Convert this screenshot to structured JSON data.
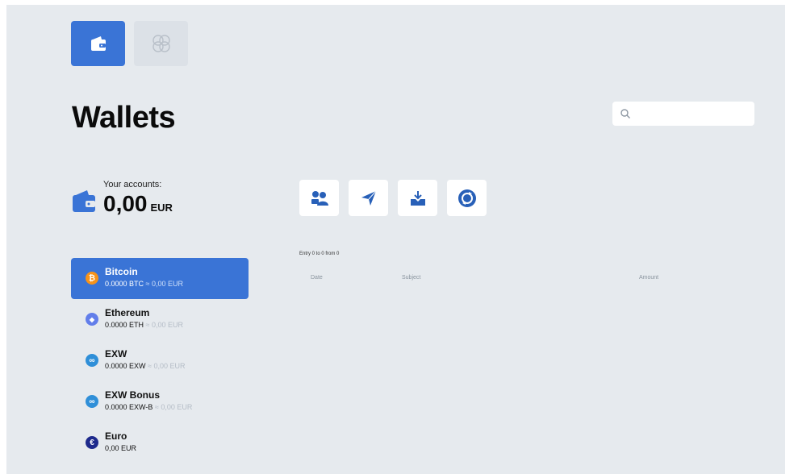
{
  "page": {
    "title": "Wallets"
  },
  "search": {
    "placeholder": ""
  },
  "summary": {
    "label": "Your accounts:",
    "amount": "0,00",
    "currency": "EUR"
  },
  "actions": [
    {
      "icon": "users-icon"
    },
    {
      "icon": "send-icon"
    },
    {
      "icon": "download-icon"
    },
    {
      "icon": "exchange-icon"
    }
  ],
  "transactions": {
    "entry_info": "Entry 0 to 0 from 0",
    "columns": [
      "Date",
      "Subject",
      "Amount"
    ]
  },
  "wallets": [
    {
      "name": "Bitcoin",
      "balance": "0.0000 BTC",
      "sep": " ≈ ",
      "eur": "0,00 EUR",
      "icon": "bitcoin-icon",
      "color": "#f7931a",
      "glyph": "₿",
      "active": true
    },
    {
      "name": "Ethereum",
      "balance": "0.0000 ETH",
      "sep": " ≈ ",
      "eur": "0,00 EUR",
      "icon": "ethereum-icon",
      "color": "#627eea",
      "glyph": "◆",
      "active": false
    },
    {
      "name": "EXW",
      "balance": "0.0000 EXW",
      "sep": " ≈ ",
      "eur": "0,00 EUR",
      "icon": "exw-icon",
      "color": "#2f8fd8",
      "glyph": "∞",
      "active": false
    },
    {
      "name": "EXW Bonus",
      "balance": "0.0000 EXW-B",
      "sep": " ≈ ",
      "eur": "0,00 EUR",
      "icon": "exw-bonus-icon",
      "color": "#2f8fd8",
      "glyph": "∞",
      "active": false
    },
    {
      "name": "Euro",
      "balance": "0,00 EUR",
      "sep": "",
      "eur": "",
      "icon": "euro-icon",
      "color": "#1e2a8c",
      "glyph": "€",
      "active": false
    }
  ],
  "colors": {
    "accent": "#3a74d6",
    "background": "#e6eaee",
    "muted": "#b4bcc6"
  }
}
